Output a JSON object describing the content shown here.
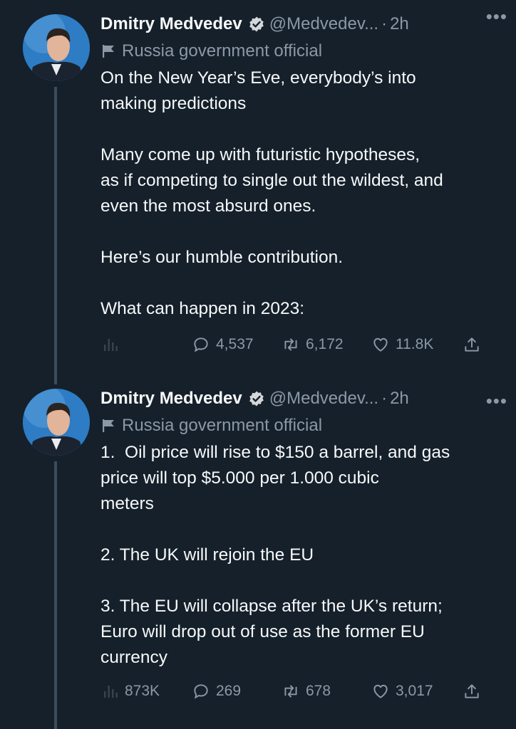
{
  "tweets": [
    {
      "author_name": "Dmitry Medvedev",
      "handle": "@Medvedev...",
      "separator": "·",
      "time": "2h",
      "more": "•••",
      "label": "Russia government official",
      "text": "On the New Year’s Eve, everybody’s into\nmaking predictions\n\nMany come up with futuristic hypotheses,\nas if competing to single out the wildest, and\neven the most absurd ones.\n\nHere’s our humble contribution.\n\nWhat can happen in 2023:",
      "stats": {
        "views": "",
        "replies": "4,537",
        "retweets": "6,172",
        "likes": "11.8K"
      }
    },
    {
      "author_name": "Dmitry Medvedev",
      "handle": "@Medvedev...",
      "separator": "·",
      "time": "2h",
      "more": "•••",
      "label": "Russia government official",
      "text": "1.  Oil price will rise to $150 a barrel, and gas\nprice will top $5.000 per 1.000 cubic\nmeters\n\n2. The UK will rejoin the EU\n\n3. The EU will collapse after the UK’s return;\nEuro will drop out of use as the former EU\ncurrency",
      "stats": {
        "views": "873K",
        "replies": "269",
        "retweets": "678",
        "likes": "3,017"
      }
    }
  ],
  "icons": {
    "verified": "verified-badge-icon",
    "label": "flag-icon",
    "analytics": "analytics-icon",
    "reply": "reply-icon",
    "retweet": "retweet-icon",
    "like": "heart-icon",
    "share": "share-icon"
  },
  "colors": {
    "background": "#15202b",
    "secondary": "#8b98a5",
    "text": "#f7f9f9"
  }
}
